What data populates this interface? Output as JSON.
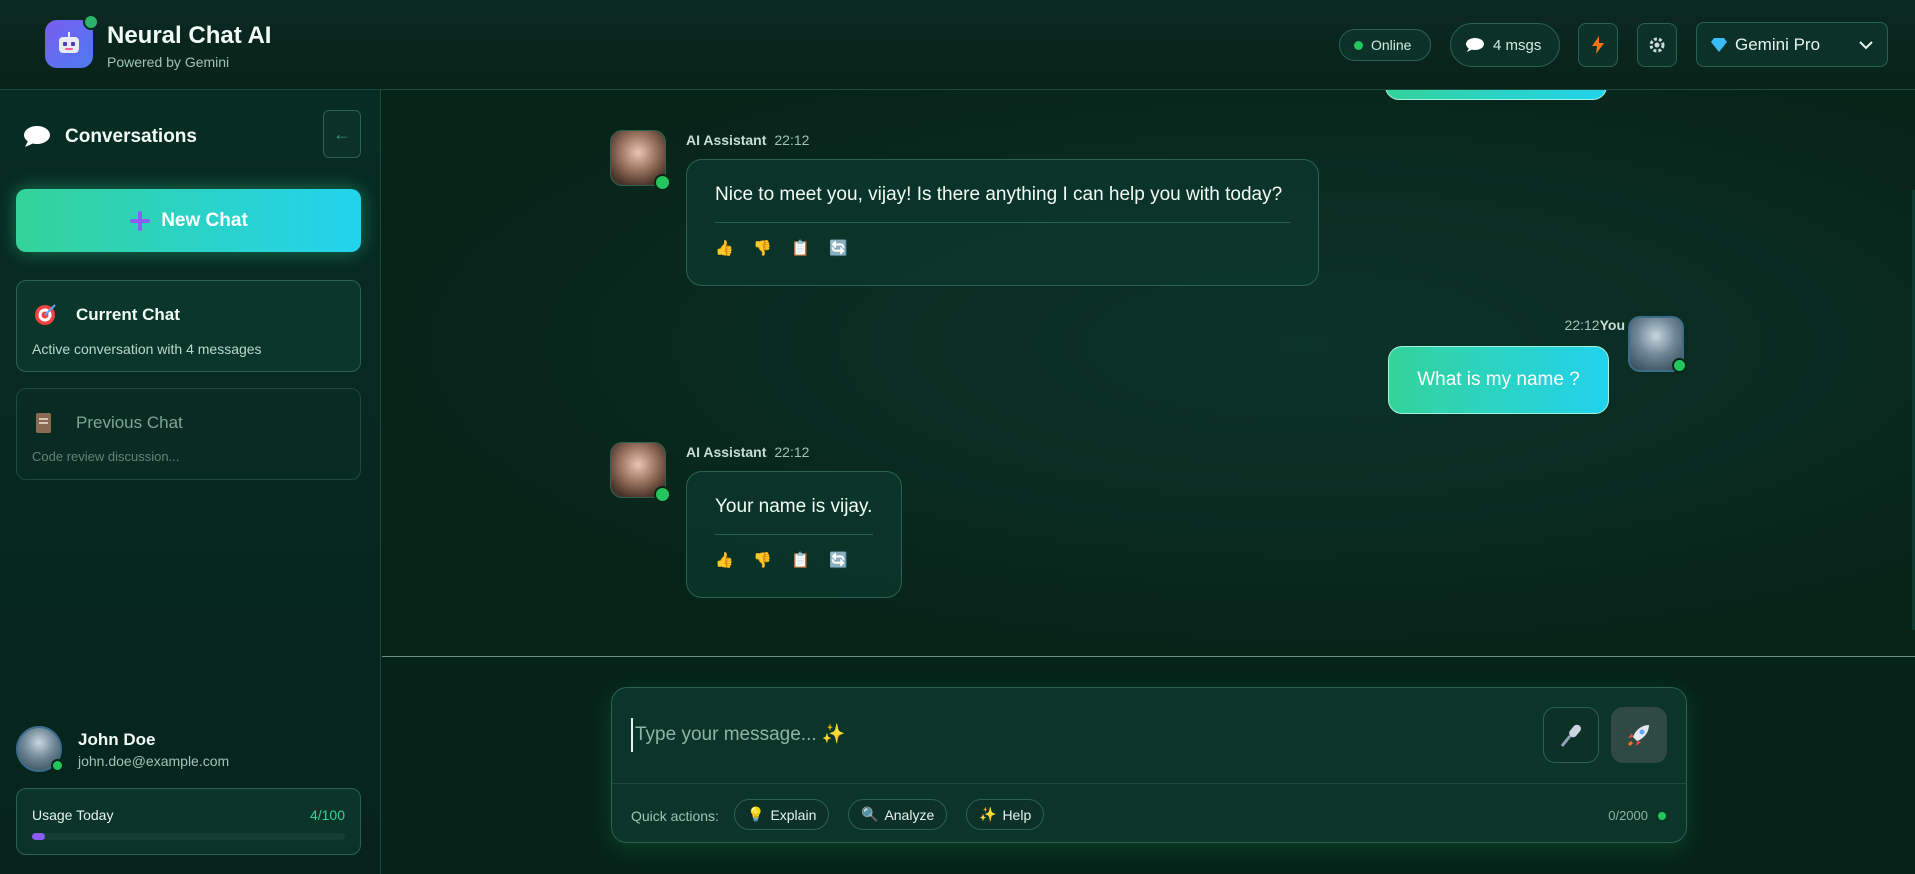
{
  "header": {
    "app_title": "Neural Chat AI",
    "app_subtitle": "Powered by Gemini",
    "status": "Online",
    "message_count": "4 msgs",
    "model": "Gemini Pro",
    "icons": {
      "logo": "robot-icon",
      "messages": "chat-bubble-icon",
      "bolt": "lightning-icon",
      "settings": "gear-icon",
      "model": "gem-icon",
      "dropdown": "chevron-down-icon"
    }
  },
  "sidebar": {
    "title": "Conversations",
    "collapse_label": "←",
    "new_chat_label": "New Chat",
    "chats": [
      {
        "title": "Current Chat",
        "description": "Active conversation with 4 messages",
        "icon": "target-icon",
        "active": true
      },
      {
        "title": "Previous Chat",
        "description": "Code review discussion...",
        "icon": "document-icon",
        "active": false
      }
    ],
    "user": {
      "name": "John Doe",
      "email": "john.doe@example.com"
    },
    "usage": {
      "label": "Usage Today",
      "count": "4/100",
      "fraction": 0.04
    }
  },
  "messages": [
    {
      "role": "assistant",
      "author": "AI Assistant",
      "time": "22:12",
      "text": "Nice to meet you, vijay! Is there anything I can help you with today?"
    },
    {
      "role": "user",
      "author": "You",
      "time": "22:12",
      "text": "What is my name ?"
    },
    {
      "role": "assistant",
      "author": "AI Assistant",
      "time": "22:12",
      "text": "Your name is vijay."
    }
  ],
  "message_actions": [
    "👍",
    "👎",
    "📋",
    "🔄"
  ],
  "composer": {
    "placeholder": "Type your message... ✨",
    "quick_actions_label": "Quick actions:",
    "quick_actions": [
      {
        "label": "Explain",
        "icon": "💡"
      },
      {
        "label": "Analyze",
        "icon": "🔍"
      },
      {
        "label": "Help",
        "icon": "✨"
      }
    ],
    "char_count": "0/2000"
  },
  "colors": {
    "accent_start": "#34d399",
    "accent_end": "#22d3ee",
    "online": "#22c55e",
    "usage": "#8b5cf6"
  }
}
